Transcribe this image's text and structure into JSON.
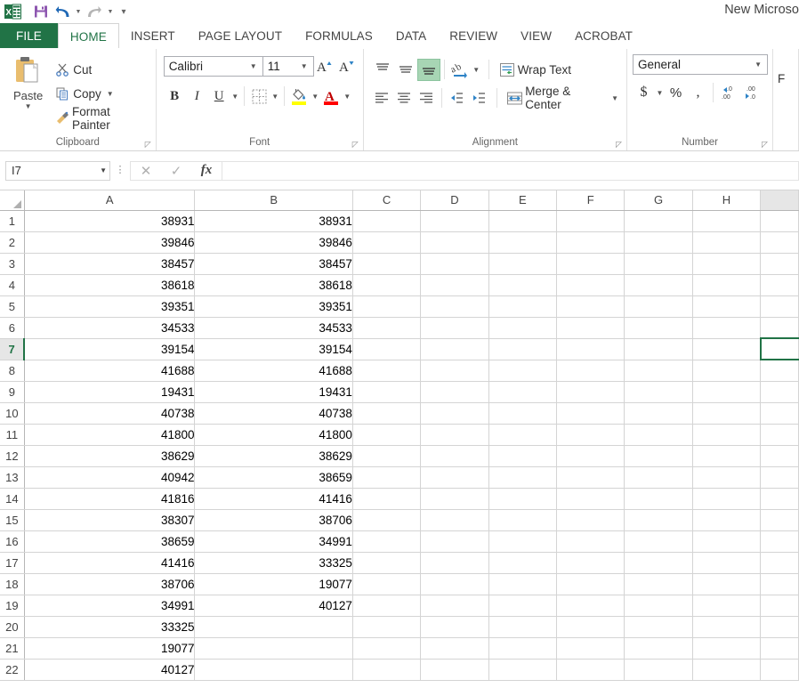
{
  "window": {
    "title": "New Microso",
    "app_icon": "excel-logo-icon"
  },
  "quick_access": {
    "save_label": "Save",
    "undo_label": "Undo",
    "redo_label": "Redo",
    "customize_label": "Customize Quick Access Toolbar"
  },
  "ribbon": {
    "tabs": [
      {
        "label": "FILE",
        "active": false,
        "file": true
      },
      {
        "label": "HOME",
        "active": true
      },
      {
        "label": "INSERT",
        "active": false
      },
      {
        "label": "PAGE LAYOUT",
        "active": false
      },
      {
        "label": "FORMULAS",
        "active": false
      },
      {
        "label": "DATA",
        "active": false
      },
      {
        "label": "REVIEW",
        "active": false
      },
      {
        "label": "VIEW",
        "active": false
      },
      {
        "label": "ACROBAT",
        "active": false
      }
    ],
    "clipboard": {
      "group_label": "Clipboard",
      "paste_label": "Paste",
      "cut_label": "Cut",
      "copy_label": "Copy",
      "format_painter_label": "Format Painter"
    },
    "font": {
      "group_label": "Font",
      "font_name": "Calibri",
      "font_size": "11",
      "grow_font_label": "A",
      "shrink_font_label": "A",
      "bold_label": "B",
      "italic_label": "I",
      "underline_label": "U",
      "fill_color": "#FFFF00",
      "font_color": "#FF0000"
    },
    "alignment": {
      "group_label": "Alignment",
      "wrap_text_label": "Wrap Text",
      "merge_center_label": "Merge & Center",
      "selected_vertical_align": "bottom-align"
    },
    "number": {
      "group_label": "Number",
      "format": "General",
      "currency_label": "$",
      "percent_label": "%",
      "comma_label": ",",
      "increase_decimal_label": ".00",
      "decrease_decimal_label": ".00"
    },
    "styles": {
      "group_label": "F"
    }
  },
  "formula_bar": {
    "name_box": "I7",
    "cancel_label": "✕",
    "enter_label": "✓",
    "function_label": "fx",
    "formula_value": ""
  },
  "sheet": {
    "columns": [
      "A",
      "B",
      "C",
      "D",
      "E",
      "F",
      "G",
      "H"
    ],
    "selected_cell": "I7",
    "selected_row": 7,
    "rows": [
      {
        "n": "1",
        "a": "38931",
        "b": "38931"
      },
      {
        "n": "2",
        "a": "39846",
        "b": "39846"
      },
      {
        "n": "3",
        "a": "38457",
        "b": "38457"
      },
      {
        "n": "4",
        "a": "38618",
        "b": "38618"
      },
      {
        "n": "5",
        "a": "39351",
        "b": "39351"
      },
      {
        "n": "6",
        "a": "34533",
        "b": "34533"
      },
      {
        "n": "7",
        "a": "39154",
        "b": "39154"
      },
      {
        "n": "8",
        "a": "41688",
        "b": "41688"
      },
      {
        "n": "9",
        "a": "19431",
        "b": "19431"
      },
      {
        "n": "10",
        "a": "40738",
        "b": "40738"
      },
      {
        "n": "11",
        "a": "41800",
        "b": "41800"
      },
      {
        "n": "12",
        "a": "38629",
        "b": "38629"
      },
      {
        "n": "13",
        "a": "40942",
        "b": "38659"
      },
      {
        "n": "14",
        "a": "41816",
        "b": "41416"
      },
      {
        "n": "15",
        "a": "38307",
        "b": "38706"
      },
      {
        "n": "16",
        "a": "38659",
        "b": "34991"
      },
      {
        "n": "17",
        "a": "41416",
        "b": "33325"
      },
      {
        "n": "18",
        "a": "38706",
        "b": "19077"
      },
      {
        "n": "19",
        "a": "34991",
        "b": "40127"
      },
      {
        "n": "20",
        "a": "33325",
        "b": ""
      },
      {
        "n": "21",
        "a": "19077",
        "b": ""
      },
      {
        "n": "22",
        "a": "40127",
        "b": ""
      }
    ]
  },
  "colors": {
    "excel_green": "#217346",
    "selection_green": "#217346",
    "header_gray": "#e6e6e6"
  }
}
